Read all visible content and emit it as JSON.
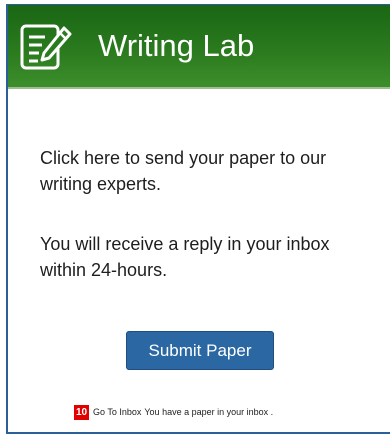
{
  "header": {
    "title": "Writing Lab",
    "icon": "writing-pencil-icon",
    "background_color": "#2a7a1e"
  },
  "main": {
    "paragraph_1": "Click here to send your paper to our writing experts.",
    "paragraph_2": "You will receive a reply in your inbox within 24-hours.",
    "submit_label": "Submit Paper",
    "submit_color": "#2b67a3"
  },
  "footer": {
    "badge_count": "10",
    "badge_color": "#e10000",
    "inbox_link_label": "Go To Inbox",
    "message": "You have a paper in your inbox ."
  }
}
